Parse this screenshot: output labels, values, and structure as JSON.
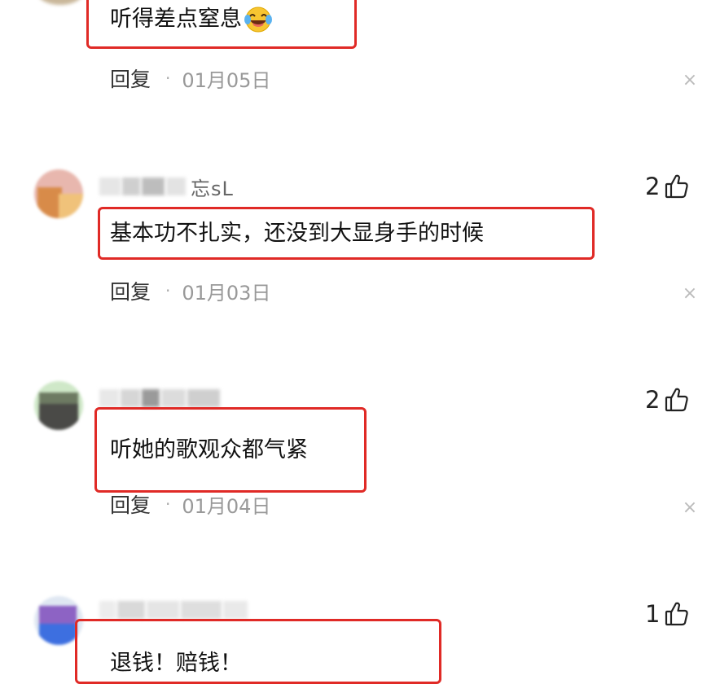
{
  "comments": [
    {
      "text": "听得差点窒息",
      "emoji": "laughing-tears-emoji",
      "reply_label": "回复",
      "date": "01月05日"
    },
    {
      "username_visible": "忘sL",
      "likes": "2",
      "text": "基本功不扎实，还没到大显身手的时候",
      "reply_label": "回复",
      "date": "01月03日"
    },
    {
      "likes": "2",
      "text": "听她的歌观众都气紧",
      "reply_label": "回复",
      "date": "01月04日"
    },
    {
      "likes": "1",
      "text": "退钱！赔钱！"
    }
  ],
  "separator": "·",
  "close_symbol": "×",
  "colors": {
    "highlight_border": "#e02a26",
    "date_text": "#999999",
    "reply_text": "#333333"
  },
  "icons": {
    "like": "thumbs-up-icon",
    "close": "close-icon"
  }
}
